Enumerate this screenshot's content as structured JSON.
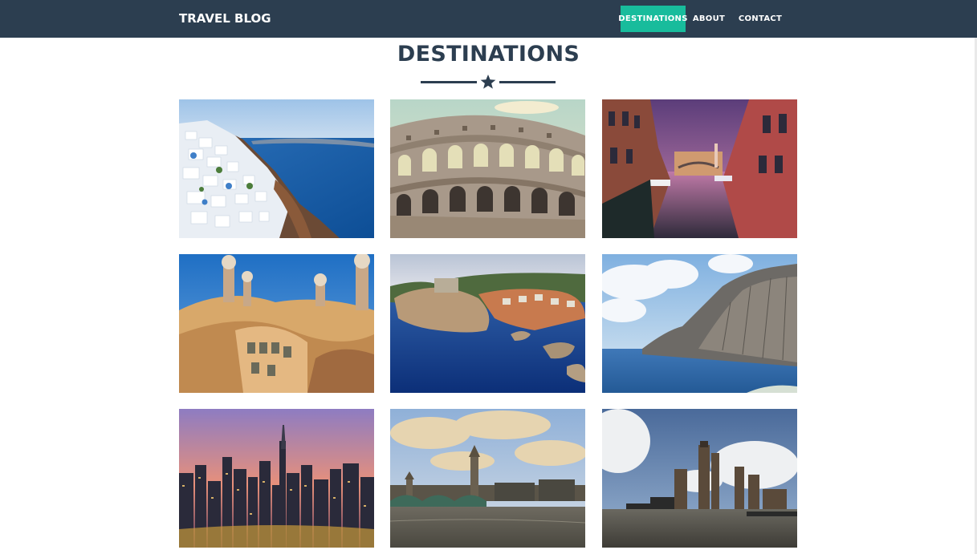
{
  "navbar": {
    "brand": "TRAVEL BLOG",
    "items": [
      {
        "label": "DESTINATIONS",
        "active": true
      },
      {
        "label": "ABOUT",
        "active": false
      },
      {
        "label": "CONTACT",
        "active": false
      }
    ]
  },
  "section": {
    "title": "DESTINATIONS",
    "divider_icon": "star-icon"
  },
  "colors": {
    "navbar_bg": "#2c3e50",
    "accent": "#18bc9c",
    "heading": "#2c3e50"
  },
  "gallery": {
    "tiles": [
      {
        "subject": "santorini"
      },
      {
        "subject": "colosseum"
      },
      {
        "subject": "venice-canal"
      },
      {
        "subject": "casa-mila-rooftop"
      },
      {
        "subject": "dubrovnik-coast"
      },
      {
        "subject": "sea-cliffs"
      },
      {
        "subject": "dubai-marina"
      },
      {
        "subject": "london-westminster"
      },
      {
        "subject": "rotterdam-skyline"
      }
    ]
  }
}
